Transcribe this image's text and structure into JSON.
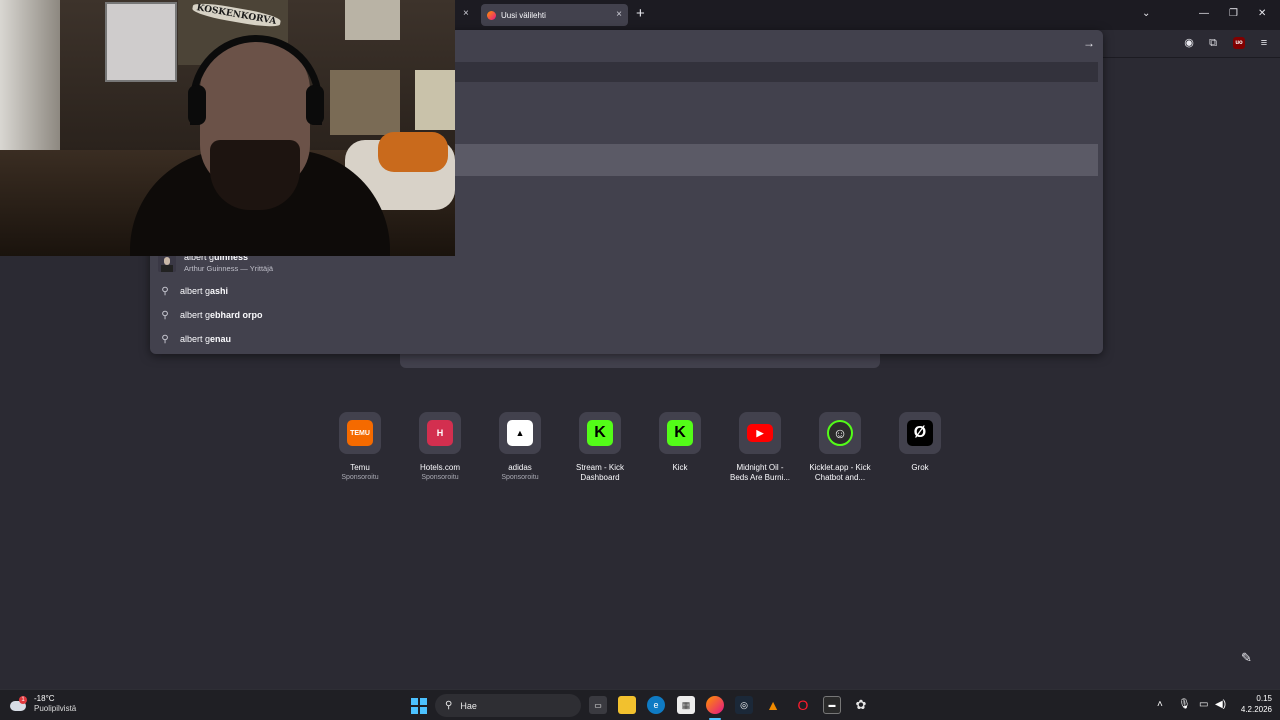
{
  "browser": {
    "tab_title": "Uusi välilehti",
    "tab_close": "×",
    "new_tab": "+",
    "tab_list": "⌄",
    "window_controls": {
      "minimize": "—",
      "maximize": "❐",
      "close": "✕"
    },
    "nav_icons": {
      "go": "→",
      "account": "◉",
      "extensions": "⧉",
      "ublock": "uo",
      "menu": "≡"
    }
  },
  "suggestions": {
    "rich": {
      "title_plain": "albert g",
      "title_bold": "uinness",
      "subtitle": "Arthur Guinness — Yrittäjä"
    },
    "items": [
      {
        "plain": "albert g",
        "bold": "ashi"
      },
      {
        "plain": "albert g",
        "bold": "ebhard orpo"
      },
      {
        "plain": "albert g",
        "bold": "enau"
      }
    ]
  },
  "webcam": {
    "sticker_text": "KOSKENKORVA"
  },
  "top_sites": [
    {
      "name": "Temu",
      "sub": "Sponsoroitu",
      "logo": "TEMU",
      "color": "#f56a00"
    },
    {
      "name": "Hotels.com",
      "sub": "Sponsoroitu",
      "logo": "H",
      "color": "#d32f4f"
    },
    {
      "name": "adidas",
      "sub": "Sponsoroitu",
      "logo": "▲",
      "color": "#ffffff"
    },
    {
      "name": "Stream - Kick",
      "name2": "Dashboard",
      "sub": "",
      "logo": "K",
      "color": "#53fc18"
    },
    {
      "name": "Kick",
      "sub": "",
      "logo": "K",
      "color": "#53fc18"
    },
    {
      "name": "Midnight Oil -",
      "name2": "Beds Are Burni...",
      "sub": "",
      "logo": "▶",
      "color": "#ff0000"
    },
    {
      "name": "Kicklet.app - Kick",
      "name2": "Chatbot and...",
      "sub": "",
      "logo": "☺",
      "color": "#2c2c2c"
    },
    {
      "name": "Grok",
      "sub": "",
      "logo": "Ø",
      "color": "#000000"
    }
  ],
  "taskbar": {
    "weather_temp": "-18°C",
    "weather_cond": "Puolipilvistä",
    "weather_badge": "1",
    "search_placeholder": "Hae",
    "time": "0.15",
    "date": "4.2.2026"
  }
}
